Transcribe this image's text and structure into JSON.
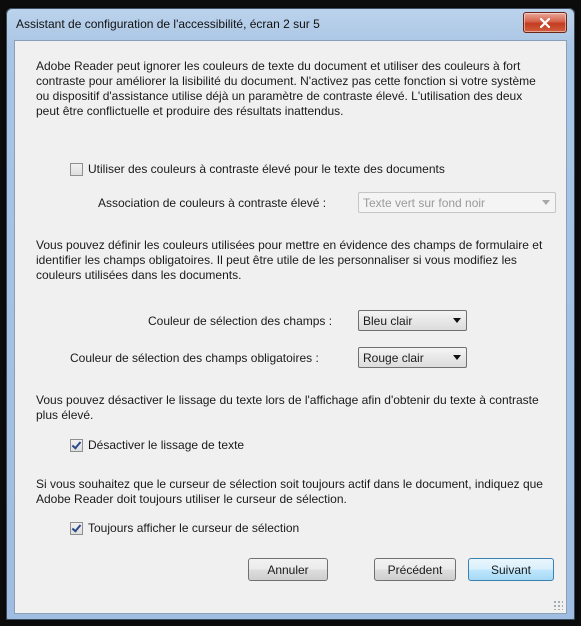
{
  "window": {
    "title": "Assistant de configuration de l'accessibilité, écran 2 sur 5"
  },
  "intro_text": "Adobe Reader peut ignorer les couleurs de texte du document et utiliser des couleurs à fort contraste pour améliorer la lisibilité du document. N'activez pas cette fonction si votre système ou dispositif d'assistance utilise déjà un paramètre de contraste élevé. L'utilisation des deux peut être conflictuelle et produire des résultats inattendus.",
  "high_contrast": {
    "checkbox_label": "Utiliser des couleurs à contraste élevé pour le texte des documents",
    "checked": false,
    "association_label": "Association de couleurs à contraste élevé :",
    "association_value": "Texte vert sur fond noir",
    "association_enabled": false
  },
  "fields_text": "Vous pouvez définir les couleurs utilisées pour mettre en évidence des champs de formulaire et identifier les champs obligatoires. Il peut être utile de les personnaliser si vous modifiez les couleurs utilisées dans les documents.",
  "field_colors": {
    "selection_label": "Couleur de sélection des champs :",
    "selection_value": "Bleu clair",
    "required_label": "Couleur de sélection des champs obligatoires :",
    "required_value": "Rouge clair"
  },
  "smoothing_text": "Vous pouvez désactiver le lissage du texte lors de l'affichage afin d'obtenir du texte à contraste plus élevé.",
  "smoothing": {
    "checkbox_label": "Désactiver le lissage de texte",
    "checked": true
  },
  "cursor_text": "Si vous souhaitez que le curseur de sélection soit toujours actif dans le document, indiquez que Adobe Reader doit toujours utiliser le curseur de sélection.",
  "cursor": {
    "checkbox_label": "Toujours afficher le curseur de sélection",
    "checked": true
  },
  "buttons": {
    "cancel": "Annuler",
    "previous": "Précédent",
    "next": "Suivant"
  }
}
